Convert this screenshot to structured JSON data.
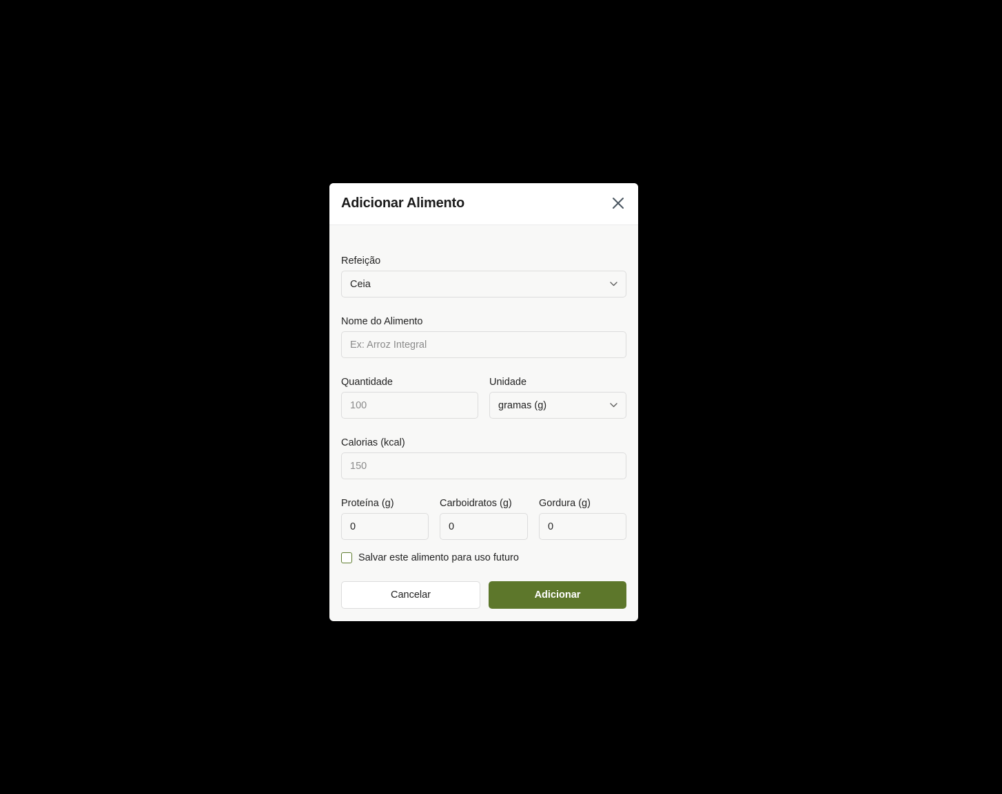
{
  "dialog": {
    "title": "Adicionar Alimento",
    "close_icon": "close-icon"
  },
  "form": {
    "meal": {
      "label": "Refeição",
      "value": "Ceia",
      "icon": "chevron-down-icon"
    },
    "food_name": {
      "label": "Nome do Alimento",
      "value": "",
      "placeholder": "Ex: Arroz Integral"
    },
    "quantity": {
      "label": "Quantidade",
      "value": "",
      "placeholder": "100"
    },
    "unit": {
      "label": "Unidade",
      "value": "gramas (g)",
      "icon": "chevron-down-icon"
    },
    "calories": {
      "label": "Calorias (kcal)",
      "value": "",
      "placeholder": "150"
    },
    "protein": {
      "label": "Proteína (g)",
      "value": "0"
    },
    "carbs": {
      "label": "Carboidratos (g)",
      "value": "0"
    },
    "fat": {
      "label": "Gordura (g)",
      "value": "0"
    },
    "save_checkbox": {
      "label": "Salvar este alimento para uso futuro",
      "checked": false
    }
  },
  "actions": {
    "cancel_label": "Cancelar",
    "submit_label": "Adicionar"
  },
  "colors": {
    "primary": "#5d772b",
    "backdrop": "#000000",
    "dialog_bg": "#f8f8f7"
  }
}
